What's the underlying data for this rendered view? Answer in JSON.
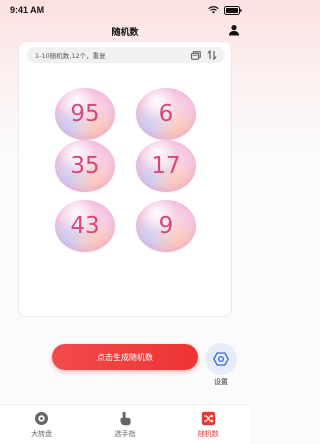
{
  "status_bar": {
    "time": "9:41 AM"
  },
  "header": {
    "title": "随机数"
  },
  "config": {
    "summary": "1-10随机数,12个，重复"
  },
  "balls": [
    "95",
    "6",
    "35",
    "17",
    "43",
    "9"
  ],
  "actions": {
    "generate_label": "点击生成随机数",
    "settings_label": "设置"
  },
  "tabs": [
    {
      "label": "大转盘",
      "icon": "wheel-icon",
      "active": false
    },
    {
      "label": "选手指",
      "icon": "finger-icon",
      "active": false
    },
    {
      "label": "随机数",
      "icon": "shuffle-icon",
      "active": true
    }
  ],
  "colors": {
    "accent": "#ee3434",
    "ball_number": "#d7477e",
    "settings_bg": "#e6edf8",
    "settings_icon": "#2f6fd6"
  }
}
